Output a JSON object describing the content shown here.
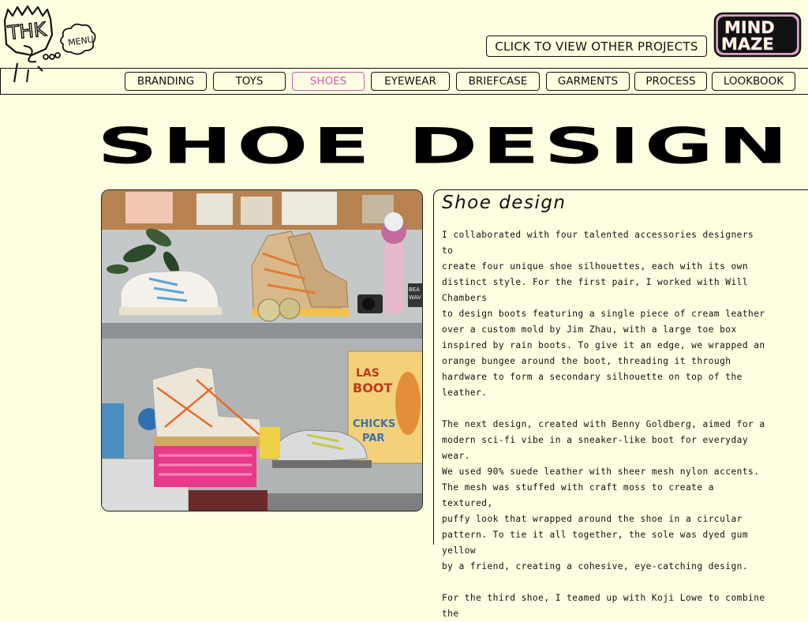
{
  "header": {
    "logo_left_text": "THK",
    "menu_label": "MENU",
    "projects_button_label": "CLICK TO VIEW OTHER PROJECTS",
    "logo_right_text": [
      "MIND",
      "MAZE"
    ]
  },
  "nav": {
    "active": "SHOES",
    "items": [
      {
        "label": "BRANDING"
      },
      {
        "label": "TOYS"
      },
      {
        "label": "SHOES"
      },
      {
        "label": "EYEWEAR"
      },
      {
        "label": "BRIEFCASE"
      },
      {
        "label": "GARMENTS"
      },
      {
        "label": "PROCESS"
      },
      {
        "label": "LOOKBOOK"
      }
    ]
  },
  "page": {
    "title": "SHOE DESIGN"
  },
  "photo": {
    "box_text_1": "LAS",
    "box_text_2": "BOOT",
    "box_text_3": "CHICKS",
    "box_text_4": "PAR",
    "sticker_text_1": "BEA",
    "sticker_text_2": "WAV"
  },
  "article": {
    "heading": "Shoe design",
    "body": "I collaborated with four talented accessories designers to\ncreate four unique shoe silhouettes, each with its own\ndistinct style. For the first pair, I worked with Will Chambers\nto design boots featuring a single piece of cream leather\nover a custom mold by Jim Zhau, with a large toe box\ninspired by rain boots. To give it an edge, we wrapped an\norange bungee around the boot, threading it through\nhardware to form a secondary silhouette on top of the\nleather.\n\nThe next design, created with Benny Goldberg, aimed for a\nmodern sci-fi vibe in a sneaker-like boot for everyday wear.\nWe used 90% suede leather with sheer mesh nylon accents.\nThe mesh was stuffed with craft moss to create a textured,\npuffy look that wrapped around the shoe in a circular\npattern. To tie it all together, the sole was dyed gum yellow\nby a friend, creating a cohesive, eye-catching design.\n\nFor the third shoe, I teamed up with Koji Lowe to combine the"
  },
  "colors": {
    "background": "#fefee1",
    "active_nav": "#c65eb0",
    "logo_pink": "#d8a3c8"
  }
}
